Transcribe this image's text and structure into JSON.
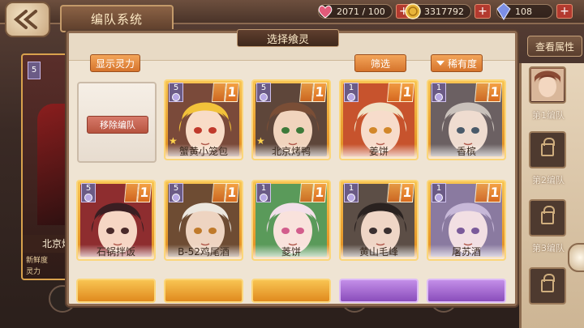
{
  "header": {
    "title": "编队系统"
  },
  "resources": {
    "stamina": "2071 / 100",
    "gold": "3317792",
    "crystal": "108"
  },
  "modal": {
    "title": "选择飨灵",
    "show_power_label": "显示灵力",
    "filter_label": "筛选",
    "rarity_label": "稀有度",
    "remove_label": "移除编队"
  },
  "left_card": {
    "level": "5",
    "name": "北京烤",
    "stat1": "新鲜度",
    "stat2": "灵力"
  },
  "right_panel": {
    "view_attr": "查看属性",
    "teams": [
      "第1编队",
      "第2编队",
      "第3编队"
    ]
  },
  "cards": [
    {
      "name": "蟹黄小笼包",
      "level": "5",
      "color": "orange",
      "star": true
    },
    {
      "name": "北京烤鸭",
      "level": "5",
      "color": "orange",
      "star": true
    },
    {
      "name": "姜饼",
      "level": "1",
      "color": "orange",
      "star": false
    },
    {
      "name": "香槟",
      "level": "1",
      "color": "orange",
      "star": false
    },
    {
      "name": "石锅拌饭",
      "level": "5",
      "color": "orange",
      "star": false
    },
    {
      "name": "B-52鸡尾酒",
      "level": "5",
      "color": "orange",
      "star": false
    },
    {
      "name": "菱饼",
      "level": "1",
      "color": "orange",
      "star": false
    },
    {
      "name": "黄山毛峰",
      "level": "1",
      "color": "orange",
      "star": false
    },
    {
      "name": "屠苏酒",
      "level": "1",
      "color": "orange",
      "star": false
    }
  ],
  "colors": {
    "accent": "#d6742c",
    "frame": "#8d6a50",
    "ssr": "#f8c452",
    "sr": "#c38ee8"
  }
}
